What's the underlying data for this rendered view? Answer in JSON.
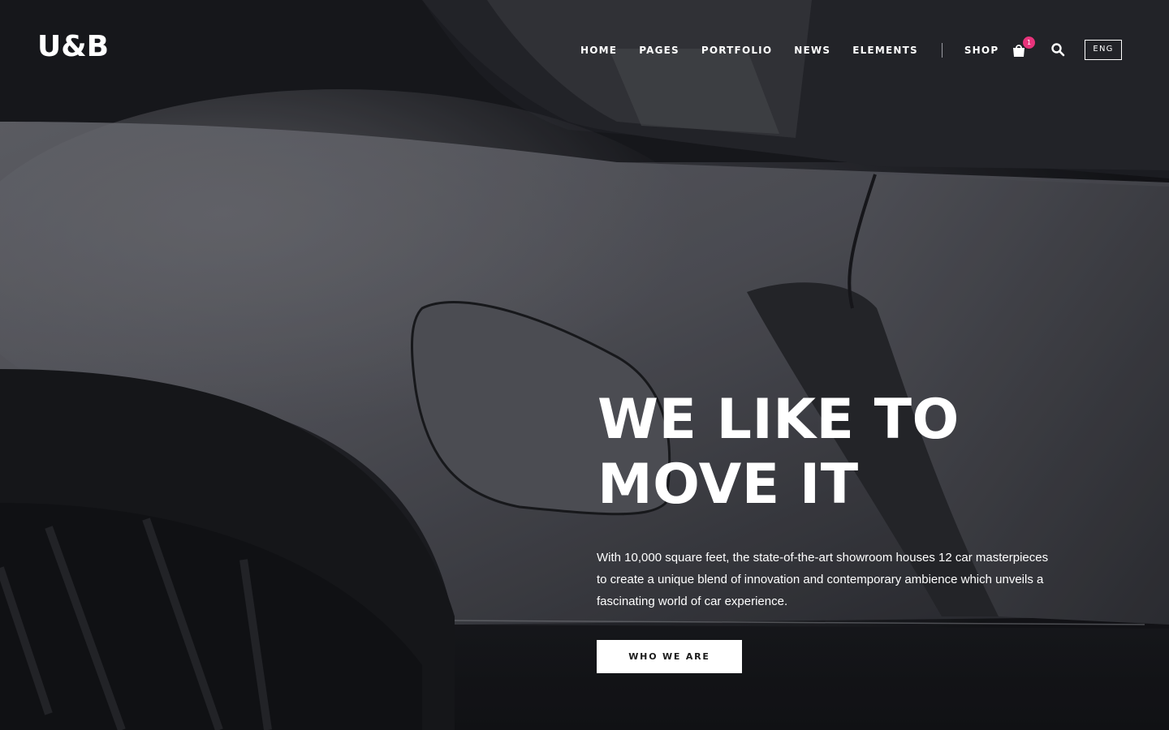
{
  "header": {
    "logo_text": "U&B",
    "nav": [
      {
        "label": "HOME"
      },
      {
        "label": "PAGES"
      },
      {
        "label": "PORTFOLIO"
      },
      {
        "label": "NEWS"
      },
      {
        "label": "ELEMENTS"
      },
      {
        "label": "SHOP"
      }
    ],
    "cart_count": "1",
    "language": "ENG",
    "icons": {
      "cart": "shopping-bag-icon",
      "search": "search-icon"
    }
  },
  "hero": {
    "headline_line1": "WE LIKE TO",
    "headline_line2": "MOVE IT",
    "body": "With 10,000 square feet, the state-of-the-art showroom houses 12 car masterpieces to create a unique blend of innovation and contemporary ambience which unveils a fascinating world of car experience.",
    "cta_label": "WHO WE ARE"
  },
  "colors": {
    "accent_badge": "#e8337b",
    "text": "#ffffff",
    "button_bg": "#ffffff"
  }
}
